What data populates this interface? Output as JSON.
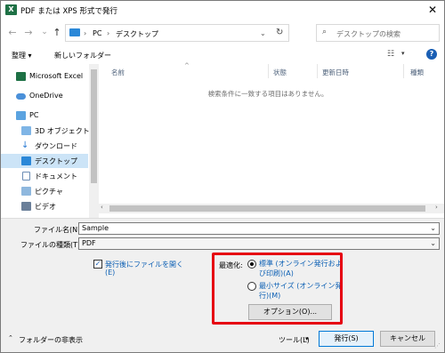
{
  "window": {
    "title": "PDF または XPS 形式で発行",
    "app_icon_letter": "X"
  },
  "nav": {
    "back": "←",
    "forward": "→",
    "recent": "⌄",
    "up": "↑"
  },
  "address": {
    "segments": [
      "PC",
      "デスクトップ"
    ],
    "separator": "›"
  },
  "search": {
    "placeholder": "デスクトップの検索"
  },
  "toolbar": {
    "organize": "整理 ▾",
    "new_folder": "新しいフォルダー"
  },
  "sidebar": {
    "items": [
      {
        "label": "Microsoft Excel",
        "icon": "excel-icon"
      },
      {
        "label": "OneDrive",
        "icon": "onedrive-icon"
      },
      {
        "label": "PC",
        "icon": "pc-icon"
      },
      {
        "label": "3D オブジェクト",
        "icon": "3d-objects-icon"
      },
      {
        "label": "ダウンロード",
        "icon": "download-icon"
      },
      {
        "label": "デスクトップ",
        "icon": "desktop-icon"
      },
      {
        "label": "ドキュメント",
        "icon": "documents-icon"
      },
      {
        "label": "ピクチャ",
        "icon": "pictures-icon"
      },
      {
        "label": "ビデオ",
        "icon": "video-icon"
      }
    ]
  },
  "filelist": {
    "columns": [
      "名前",
      "状態",
      "更新日時",
      "種類"
    ],
    "empty_message": "検索条件に一致する項目はありません。"
  },
  "form": {
    "filename_label": "ファイル名(N):",
    "filename_value": "Sample",
    "filetype_label": "ファイルの種類(T):",
    "filetype_value": "PDF",
    "open_after_line1": "発行後にファイルを開く",
    "open_after_line2": "(E)",
    "optimize_label": "最適化:",
    "opt_standard_line1": "標準 (オンライン発行およ",
    "opt_standard_line2": "び印刷)(A)",
    "opt_min_line1": "最小サイズ (オンライン発",
    "opt_min_line2": "行)(M)",
    "options_button": "オプション(O)..."
  },
  "footer": {
    "hide_folders": "フォルダーの非表示",
    "tools": "ツール(L)",
    "publish": "発行(S)",
    "cancel": "キャンセル"
  },
  "colors": {
    "accent": "#0078d7",
    "highlight": "#e60012",
    "selected": "#cce4f7",
    "excel": "#1e7145"
  }
}
